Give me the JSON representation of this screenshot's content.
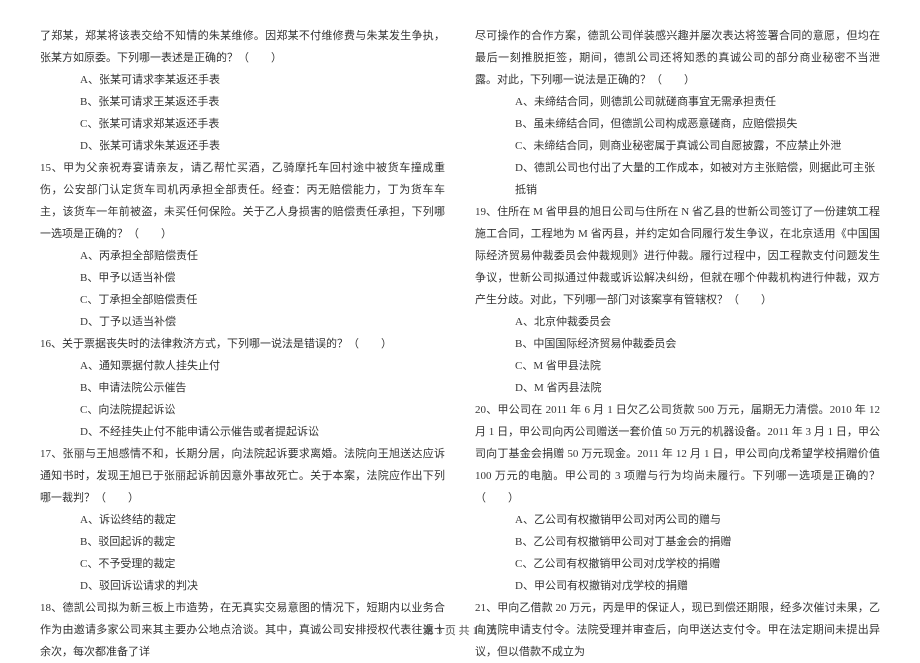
{
  "left": {
    "p1": "了郑某，郑某将该表交给不知情的朱某维修。因郑某不付维修费与朱某发生争执，张某方如原委。下列哪一表述是正确的？（　　）",
    "opt_a": "A、张某可请求李某返还手表",
    "opt_b": "B、张某可请求王某返还手表",
    "opt_c": "C、张某可请求郑某返还手表",
    "opt_d": "D、张某可请求朱某返还手表",
    "q15": "15、甲为父亲祝寿宴请亲友，请乙帮忙买酒，乙骑摩托车回村途中被货车撞成重伤，公安部门认定货车司机丙承担全部责任。经查：丙无赔偿能力，丁为货车车主，该货车一年前被盗，未买任何保险。关于乙人身损害的赔偿责任承担，下列哪一选项是正确的？（　　）",
    "q15_a": "A、丙承担全部赔偿责任",
    "q15_b": "B、甲予以适当补偿",
    "q15_c": "C、丁承担全部赔偿责任",
    "q15_d": "D、丁予以适当补偿",
    "q16": "16、关于票据丧失时的法律救济方式，下列哪一说法是错误的？（　　）",
    "q16_a": "A、通知票据付款人挂失止付",
    "q16_b": "B、申请法院公示催告",
    "q16_c": "C、向法院提起诉讼",
    "q16_d": "D、不经挂失止付不能申请公示催告或者提起诉讼",
    "q17": "17、张丽与王旭感情不和，长期分居，向法院起诉要求离婚。法院向王旭送达应诉通知书时，发现王旭已于张丽起诉前因意外事故死亡。关于本案，法院应作出下列哪一裁判？（　　）",
    "q17_a": "A、诉讼终结的裁定",
    "q17_b": "B、驳回起诉的裁定",
    "q17_c": "C、不予受理的裁定",
    "q17_d": "D、驳回诉讼请求的判决",
    "q18": "18、德凯公司拟为新三板上市造势，在无真实交易意图的情况下，短期内以业务合作为由邀请多家公司来其主要办公地点洽谈。其中，真诚公司安排授权代表往返十余次，每次都准备了详"
  },
  "right": {
    "p1": "尽可操作的合作方案，德凯公司佯装感兴趣并屡次表达将签署合同的意愿，但均在最后一刻推脱拒签，期间，德凯公司还将知悉的真诚公司的部分商业秘密不当泄露。对此，下列哪一说法是正确的？（　　）",
    "r_a": "A、未缔结合同，则德凯公司就磋商事宜无需承担责任",
    "r_b": "B、虽未缔结合同，但德凯公司构成恶意磋商，应赔偿损失",
    "r_c": "C、未缔结合同，则商业秘密属于真诚公司自愿披露，不应禁止外泄",
    "r_d": "D、德凯公司也付出了大量的工作成本，如被对方主张赔偿，则据此可主张抵销",
    "q19": "19、住所在 M 省甲县的旭日公司与住所在 N 省乙县的世新公司签订了一份建筑工程施工合同，工程地为 M 省丙县，并约定如合同履行发生争议，在北京适用《中国国际经济贸易仲裁委员会仲裁规则》进行仲裁。履行过程中，因工程款支付问题发生争议，世新公司拟通过仲裁或诉讼解决纠纷，但就在哪个仲裁机构进行仲裁，双方产生分歧。对此，下列哪一部门对该案享有管辖权？（　　）",
    "q19_a": "A、北京仲裁委员会",
    "q19_b": "B、中国国际经济贸易仲裁委员会",
    "q19_c": "C、M 省甲县法院",
    "q19_d": "D、M 省丙县法院",
    "q20": "20、甲公司在 2011 年 6 月 1 日欠乙公司货款 500 万元，届期无力清偿。2010 年 12 月 1 日，甲公司向丙公司赠送一套价值 50 万元的机器设备。2011 年 3 月 1 日，甲公司向丁基金会捐赠 50 万元现金。2011 年 12 月 1 日，甲公司向戊希望学校捐赠价值 100 万元的电脑。甲公司的 3 项赠与行为均尚未履行。下列哪一选项是正确的？（　　）",
    "q20_a": "A、乙公司有权撤销甲公司对丙公司的赠与",
    "q20_b": "B、乙公司有权撤销甲公司对丁基金会的捐赠",
    "q20_c": "C、乙公司有权撤销甲公司对戊学校的捐赠",
    "q20_d": "D、甲公司有权撤销对戊学校的捐赠",
    "q21": "21、甲向乙借款 20 万元，丙是甲的保证人，现已到偿还期限，经多次催讨未果，乙向法院申请支付令。法院受理并审查后，向甲送达支付令。甲在法定期间未提出异议，但以借款不成立为"
  },
  "footer": "第 3 页 共 19 页"
}
